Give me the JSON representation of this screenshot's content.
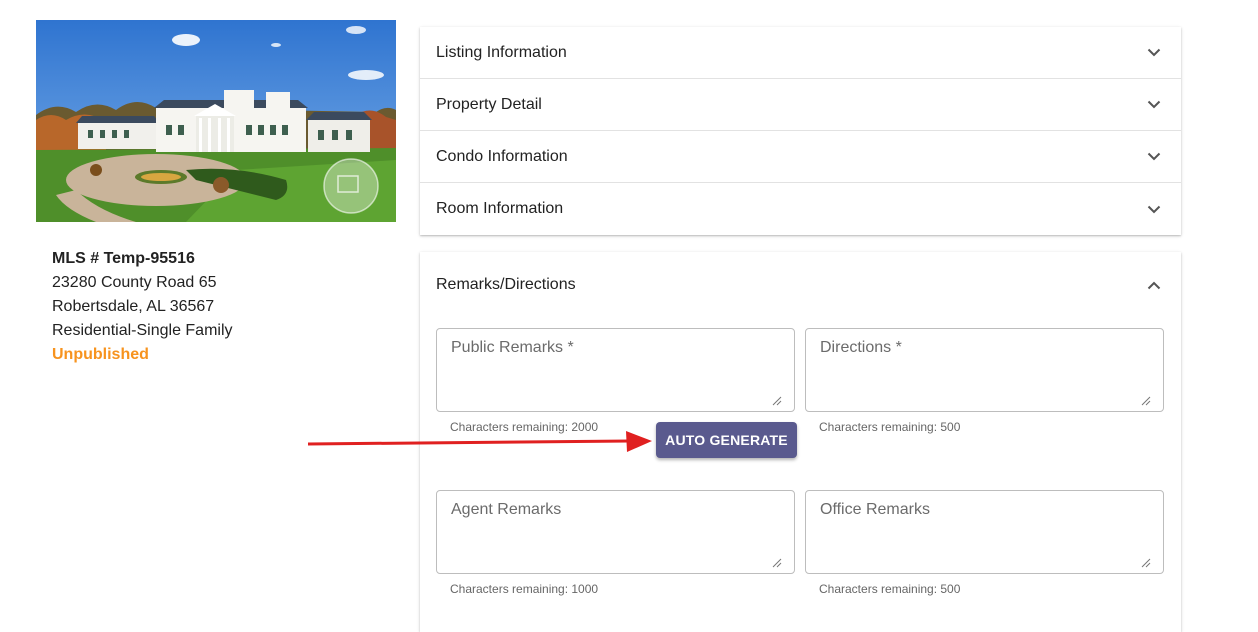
{
  "listing": {
    "mls_number": "MLS # Temp-95516",
    "address_line1": "23280 County Road 65",
    "address_line2": "Robertsdale, AL 36567",
    "property_type": "Residential-Single Family",
    "status": "Unpublished",
    "status_color": "#f7931e"
  },
  "accordion": {
    "sections": [
      {
        "label": "Listing Information",
        "icon": "chevron-down-icon"
      },
      {
        "label": "Property Detail",
        "icon": "chevron-down-icon"
      },
      {
        "label": "Condo Information",
        "icon": "chevron-down-icon"
      },
      {
        "label": "Room Information",
        "icon": "chevron-down-icon"
      }
    ]
  },
  "remarks": {
    "title": "Remarks/Directions",
    "icon": "chevron-up-icon",
    "public_remarks": {
      "placeholder": "Public Remarks *",
      "value": "",
      "helper": "Characters remaining: 2000"
    },
    "directions": {
      "placeholder": "Directions *",
      "value": "",
      "helper": "Characters remaining: 500"
    },
    "agent_remarks": {
      "placeholder": "Agent Remarks",
      "value": "",
      "helper": "Characters remaining: 1000"
    },
    "office_remarks": {
      "placeholder": "Office Remarks",
      "value": "",
      "helper": "Characters remaining: 500"
    },
    "auto_generate_label": "AUTO GENERATE"
  },
  "colors": {
    "accent_button": "#5a5a8e",
    "annotation_arrow": "#e02020"
  }
}
